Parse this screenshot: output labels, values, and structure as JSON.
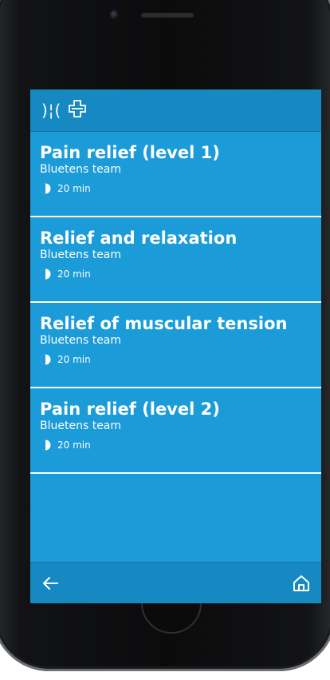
{
  "app": {
    "logo_text": ")¦(",
    "logo_icon": "plus-cross-icon",
    "accent_color": "#1b9bd8",
    "bar_color": "#1689c3"
  },
  "programs": [
    {
      "title": "Pain relief (level 1)",
      "author": "Bluetens team",
      "duration": "20 min"
    },
    {
      "title": "Relief and relaxation",
      "author": "Bluetens team",
      "duration": "20 min"
    },
    {
      "title": "Relief of muscular tension",
      "author": "Bluetens team",
      "duration": "20 min"
    },
    {
      "title": "Pain relief (level 2)",
      "author": "Bluetens team",
      "duration": "20 min"
    }
  ],
  "nav": {
    "back_icon": "arrow-left-icon",
    "home_icon": "home-icon"
  }
}
